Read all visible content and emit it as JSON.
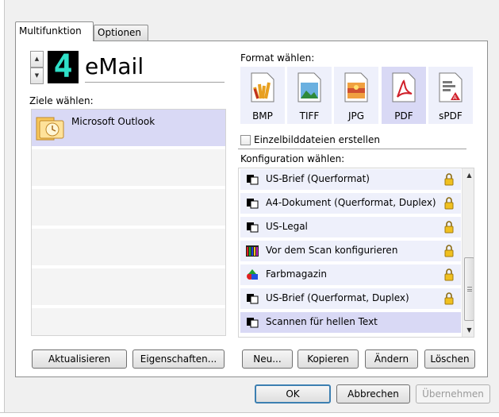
{
  "tabs": [
    {
      "label": "Multifunktion"
    },
    {
      "label": "Optionen"
    }
  ],
  "destination": {
    "number": "4",
    "name": "eMail",
    "choose_label": "Ziele wählen:",
    "items": [
      {
        "label": "Microsoft Outlook",
        "icon": "outlook-icon",
        "selected": true
      }
    ]
  },
  "left_buttons": {
    "refresh": "Aktualisieren",
    "properties": "Eigenschaften..."
  },
  "format": {
    "label": "Format wählen:",
    "options": [
      {
        "label": "BMP",
        "icon": "bmp-icon"
      },
      {
        "label": "TIFF",
        "icon": "tiff-icon"
      },
      {
        "label": "JPG",
        "icon": "jpg-icon"
      },
      {
        "label": "PDF",
        "icon": "pdf-icon",
        "selected": true
      },
      {
        "label": "sPDF",
        "icon": "spdf-icon"
      }
    ],
    "single_image_checkbox": "Einzelbilddateien erstellen",
    "single_image_checked": false
  },
  "config": {
    "label": "Konfiguration wählen:",
    "items": [
      {
        "label": "US-Brief (Querformat)",
        "icon": "document-icon",
        "locked": true
      },
      {
        "label": "A4-Dokument (Querformat, Duplex)",
        "icon": "document-icon",
        "locked": true
      },
      {
        "label": "US-Legal",
        "icon": "document-icon",
        "locked": true
      },
      {
        "label": "Vor dem Scan konfigurieren",
        "icon": "color-bars-icon",
        "locked": true
      },
      {
        "label": "Farbmagazin",
        "icon": "color-shapes-icon",
        "locked": true
      },
      {
        "label": "US-Brief (Querformat, Duplex)",
        "icon": "document-icon",
        "locked": true
      },
      {
        "label": "Scannen für hellen Text",
        "icon": "document-icon",
        "locked": false,
        "selected": true
      }
    ]
  },
  "config_buttons": {
    "new": "Neu...",
    "copy": "Kopieren",
    "change": "Ändern",
    "delete": "Löschen"
  },
  "dialog_buttons": {
    "ok": "OK",
    "cancel": "Abbrechen",
    "apply": "Übernehmen"
  }
}
